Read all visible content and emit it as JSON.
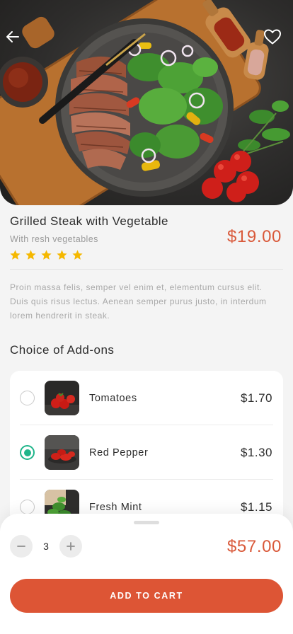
{
  "header": {
    "back_icon": "arrow-left-icon",
    "favorite_icon": "heart-outline-icon"
  },
  "product": {
    "title": "Grilled Steak with Vegetable",
    "subtitle": "With resh vegetables",
    "price": "$19.00",
    "rating": 5,
    "rating_max": 5,
    "description": "Proin massa felis, semper vel enim et, elementum cursus elit. Duis quis risus lectus. Aenean semper purus justo, in interdum lorem hendrerit in steak."
  },
  "addons": {
    "title": "Choice of Add-ons",
    "items": [
      {
        "name": "Tomatoes",
        "price": "$1.70",
        "selected": false
      },
      {
        "name": "Red Pepper",
        "price": "$1.30",
        "selected": true
      },
      {
        "name": "Fresh Mint",
        "price": "$1.15",
        "selected": false
      }
    ]
  },
  "cart": {
    "quantity": "3",
    "total": "$57.00",
    "add_to_cart_label": "ADD TO CART",
    "minus_icon": "minus-icon",
    "plus_icon": "plus-icon"
  },
  "colors": {
    "accent": "#dd5535",
    "price": "#d9593a",
    "selected": "#1fb58a",
    "star": "#f5b800",
    "background": "#f4f4f4"
  }
}
